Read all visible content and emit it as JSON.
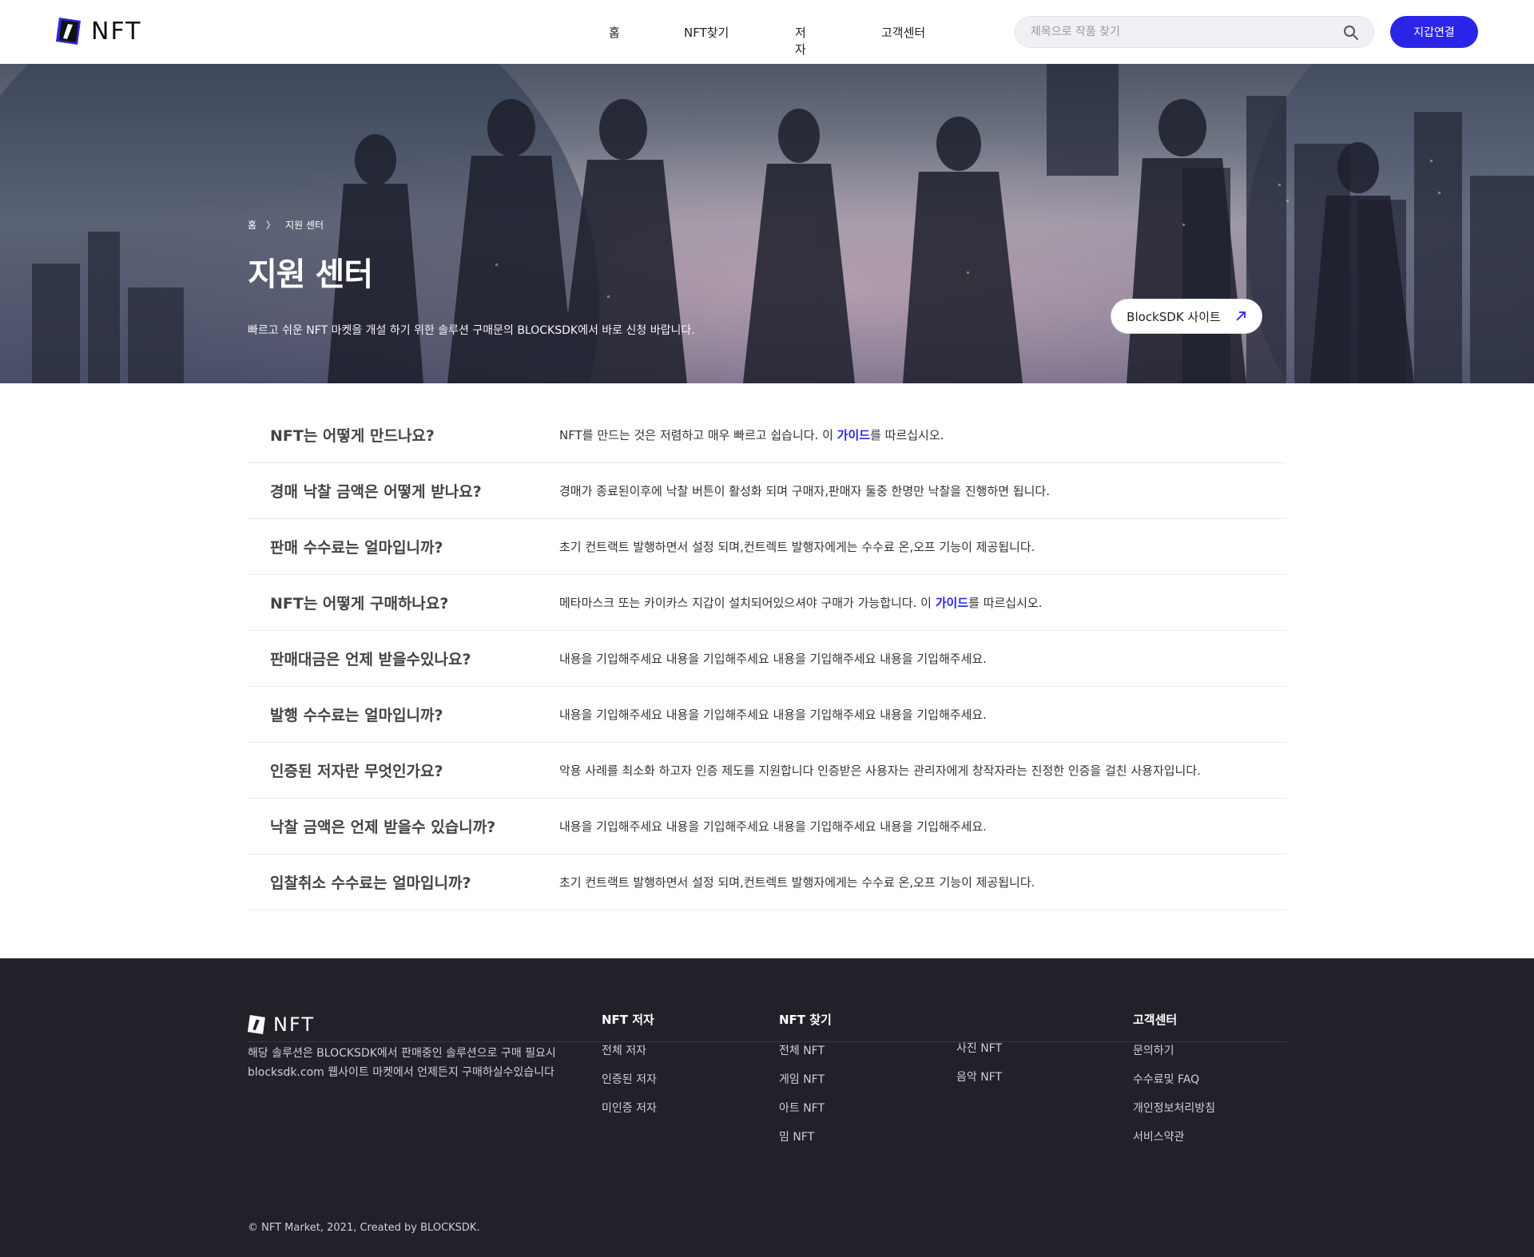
{
  "header": {
    "logo_text": "NFT",
    "nav": {
      "home": "홈",
      "find": "NFT찾기",
      "author": "저자",
      "cs": "고객센터"
    },
    "search_placeholder": "제목으로 작품 찾기",
    "wallet_button": "지갑연결",
    "brand_color": "#2a25e8"
  },
  "hero": {
    "breadcrumb_home": "홈",
    "breadcrumb_sep": "〉",
    "breadcrumb_current": "지원 센터",
    "title": "지원 센터",
    "description": "빠르고 쉬운 NFT 마켓을 개설 하기 위한 솔루션 구매문의 BLOCKSDK에서 바로 신청 바랍니다.",
    "button_label": "BlockSDK 사이트",
    "button_icon": "arrow-up-right-icon"
  },
  "faq": [
    {
      "q": "NFT는 어떻게 만드나요?",
      "a_pre": "NFT를 만드는 것은 저렴하고 매우 빠르고 쉽습니다. 이 ",
      "a_link": "가이드",
      "a_post": "를 따르십시오."
    },
    {
      "q": "경매 낙찰 금액은 어떻게 받나요?",
      "a_pre": "경매가 종료된이후에 낙찰 버튼이 활성화 되며 구매자,판매자 둘중 한명만 낙찰을 진행하면 됩니다.",
      "a_link": "",
      "a_post": ""
    },
    {
      "q": "판매 수수료는 얼마입니까?",
      "a_pre": "초기 컨트랙트 발행하면서 설정 되며,컨트렉트 발행자에게는 수수료 온,오프 기능이 제공됩니다.",
      "a_link": "",
      "a_post": ""
    },
    {
      "q": "NFT는 어떻게 구매하나요?",
      "a_pre": "메타마스크 또는 카이카스 지갑이 설치되어있으셔야 구매가 가능합니다. 이 ",
      "a_link": "가이드",
      "a_post": "를 따르십시오."
    },
    {
      "q": "판매대금은 언제 받을수있나요?",
      "a_pre": "내용을 기입해주세요 내용을 기입해주세요 내용을 기입해주세요 내용을 기입해주세요.",
      "a_link": "",
      "a_post": ""
    },
    {
      "q": "발행 수수료는 얼마입니까?",
      "a_pre": "내용을 기입해주세요 내용을 기입해주세요 내용을 기입해주세요 내용을 기입해주세요.",
      "a_link": "",
      "a_post": ""
    },
    {
      "q": "인증된 저자란 무엇인가요?",
      "a_pre": "악용 사례를 최소화 하고자 인증 제도를 지원합니다 인증받은 사용자는 관리자에게 창작자라는 진정한 인증을 걸친 사용자입니다.",
      "a_link": "",
      "a_post": ""
    },
    {
      "q": "낙찰 금액은 언제 받을수 있습니까?",
      "a_pre": "내용을 기입해주세요 내용을 기입해주세요 내용을 기입해주세요 내용을 기입해주세요.",
      "a_link": "",
      "a_post": ""
    },
    {
      "q": "입찰취소 수수료는 얼마입니까?",
      "a_pre": "초기 컨트랙트 발행하면서 설정 되며,컨트렉트 발행자에게는 수수료 온,오프 기능이 제공됩니다.",
      "a_link": "",
      "a_post": ""
    }
  ],
  "footer": {
    "logo_text": "NFT",
    "description": "해당 솔루션은 BLOCKSDK에서 판매중인 솔루션으로 구매 필요시 blocksdk.com 웹사이트 마켓에서 언제든지 구매하실수있습니다",
    "col_author": {
      "title": "NFT 저자",
      "items": [
        "전체 저자",
        "인증된 저자",
        "미인증 저자"
      ]
    },
    "col_find": {
      "title": "NFT 찾기",
      "items": [
        "전체 NFT",
        "게임 NFT",
        "아트 NFT",
        "밈 NFT"
      ]
    },
    "col_find2": {
      "items": [
        "사진 NFT",
        "음악 NFT"
      ]
    },
    "col_cs": {
      "title": "고객센터",
      "items": [
        "문의하기",
        "수수료및 FAQ",
        "개인정보처리방침",
        "서비스약관"
      ]
    },
    "copyright": "© NFT Market, 2021, Created by BLOCKSDK."
  }
}
